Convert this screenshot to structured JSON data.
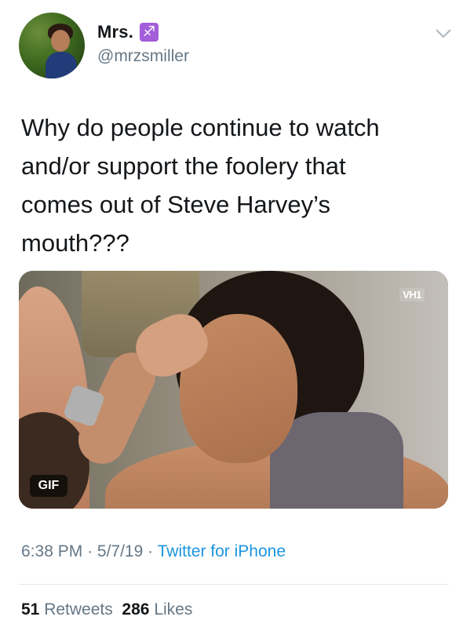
{
  "user": {
    "display_name": "Mrs.",
    "zodiac_symbol": "♐",
    "handle": "@mrzsmiller"
  },
  "tweet": {
    "text": "Why do people continue to watch\nand/or support the foolery that\ncomes out of Steve Harvey’s\nmouth???"
  },
  "media": {
    "badge": "GIF",
    "watermark": "VH1"
  },
  "meta": {
    "time": "6:38 PM",
    "date": "5/7/19",
    "source": "Twitter for iPhone",
    "separator": "·"
  },
  "stats": {
    "retweets_count": "51",
    "retweets_label": "Retweets",
    "likes_count": "286",
    "likes_label": "Likes"
  },
  "colors": {
    "link": "#1b95e0",
    "muted": "#657786",
    "zodiac_badge": "#a35ed9"
  }
}
